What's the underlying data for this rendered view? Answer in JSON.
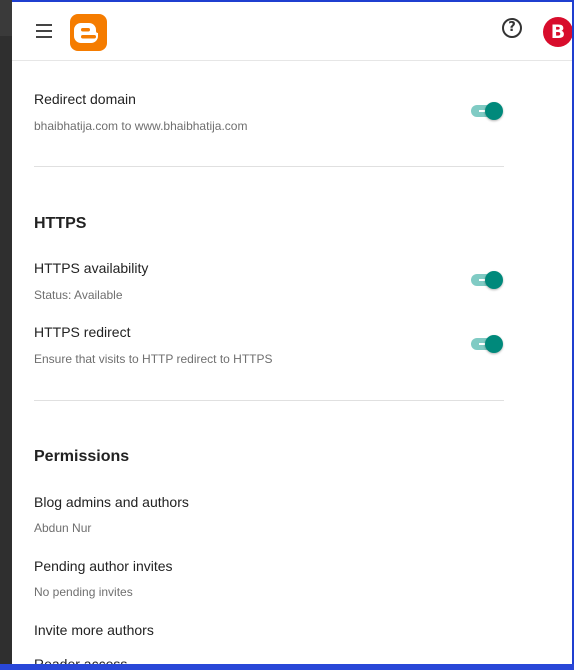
{
  "header": {
    "menu_icon": "hamburger-menu-icon",
    "logo_icon": "blogger-logo-icon",
    "help_icon": "help-circle-icon",
    "help_glyph": "?",
    "avatar_letter": "B",
    "accent_logo": "#f57c00",
    "avatar_color": "#d80d2c"
  },
  "redirect_domain": {
    "title": "Redirect domain",
    "subtitle": "bhaibhatija.com to www.bhaibhatija.com",
    "enabled": true
  },
  "https": {
    "heading": "HTTPS",
    "availability": {
      "title": "HTTPS availability",
      "subtitle": "Status: Available",
      "enabled": true
    },
    "redirect": {
      "title": "HTTPS redirect",
      "subtitle": "Ensure that visits to HTTP redirect to HTTPS",
      "enabled": true
    }
  },
  "permissions": {
    "heading": "Permissions",
    "admins": {
      "title": "Blog admins and authors",
      "subtitle": "Abdun Nur"
    },
    "pending": {
      "title": "Pending author invites",
      "subtitle": "No pending invites"
    },
    "invite": {
      "title": "Invite more authors"
    },
    "reader": {
      "title": "Reader access"
    }
  },
  "colors": {
    "toggle_on": "#00897b",
    "toggle_track": "#80cbc4"
  }
}
